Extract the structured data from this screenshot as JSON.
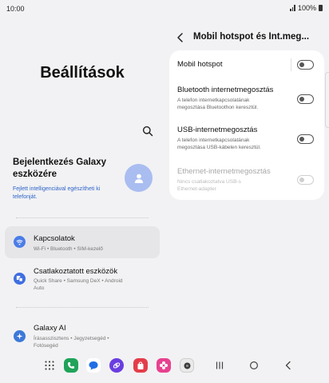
{
  "status_bar": {
    "time": "10:00",
    "battery": "100%"
  },
  "settings": {
    "title": "Beállítások",
    "account": {
      "title_line1": "Bejelentkezés Galaxy",
      "title_line2": "eszközére",
      "subtitle_line1": "Fejlett intelligenciával egészítheti ki",
      "subtitle_line2": "telefonját."
    },
    "items": [
      {
        "label": "Kapcsolatok",
        "sub1": "Wi-Fi  •  Bluetooth  •  SIM-kezelő",
        "sub2": "",
        "icon": "wifi-icon",
        "color": "#4a7de8"
      },
      {
        "label": "Csatlakoztatott eszközök",
        "sub1": "Quick Share  •  Samsung DeX  •  Android",
        "sub2": "Auto",
        "icon": "connected-devices-icon",
        "color": "#3f6fe0"
      },
      {
        "label": "Galaxy AI",
        "sub1": "Írásasszisztens  •  Jegyzetsegéd  •",
        "sub2": "Fotósegéd",
        "icon": "galaxy-ai-icon",
        "color": "#3d78d8"
      }
    ]
  },
  "hotspot": {
    "title": "Mobil hotspot és Int.meg...",
    "rows": [
      {
        "label": "Mobil hotspot",
        "sub1": "",
        "sub2": "",
        "enabled": true
      },
      {
        "label": "Bluetooth internetmegosztás",
        "sub1": "A telefon internetkapcsolatának",
        "sub2": "megosztása Bluetoothon keresztül.",
        "enabled": true
      },
      {
        "label": "USB-internetmegosztás",
        "sub1": "A telefon internetkapcsolatának",
        "sub2": "megosztása USB-kábelen keresztül.",
        "enabled": true
      },
      {
        "label": "Ethernet-internetmegosztás",
        "sub1": "Nincs csatlakoztatva USB-s",
        "sub2": "Ethernet-adapter",
        "enabled": false
      }
    ]
  },
  "dock": {
    "apps": [
      {
        "name": "apps-grid-icon"
      },
      {
        "name": "phone-app-icon",
        "color": "#1fa35a"
      },
      {
        "name": "messages-app-icon",
        "color": "#1f6fe5"
      },
      {
        "name": "internet-app-icon",
        "color": "#6a3de0"
      },
      {
        "name": "store-app-icon",
        "color": "#e43c4a"
      },
      {
        "name": "gallery-app-icon",
        "color": "#e8408f"
      },
      {
        "name": "camera-app-icon",
        "color": "#3a3a3a"
      }
    ],
    "nav": [
      "recents-nav-icon",
      "home-nav-icon",
      "back-nav-icon"
    ]
  }
}
